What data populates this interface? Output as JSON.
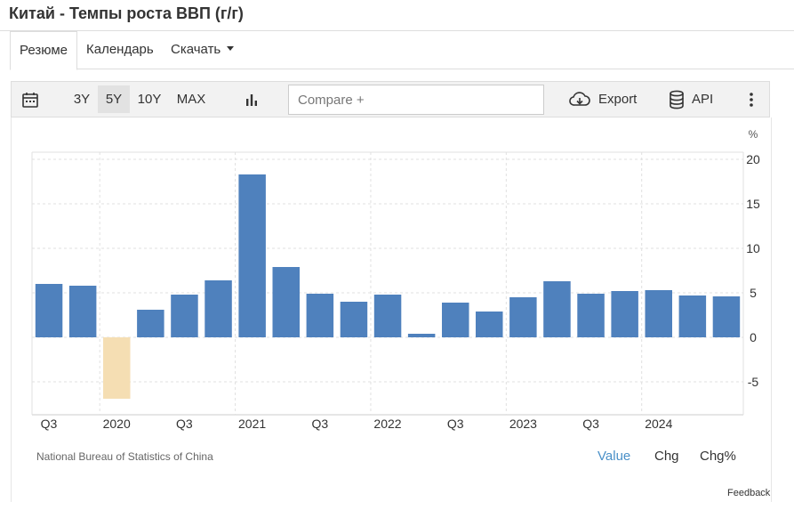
{
  "page": {
    "title": "Китай - Темпы роста ВВП (г/г)"
  },
  "tabs": [
    {
      "label": "Резюме",
      "active": true
    },
    {
      "label": "Календарь",
      "active": false
    },
    {
      "label": "Скачать",
      "active": false
    }
  ],
  "toolbar": {
    "ranges": [
      {
        "label": "3Y",
        "active": false
      },
      {
        "label": "5Y",
        "active": true
      },
      {
        "label": "10Y",
        "active": false
      },
      {
        "label": "MAX",
        "active": false
      }
    ],
    "compare_placeholder": "Compare +",
    "export_label": "Export",
    "api_label": "API"
  },
  "chart_data": {
    "type": "bar",
    "unit": "%",
    "categories": [
      "2019 Q3",
      "2019 Q4",
      "2020 Q1",
      "2020 Q2",
      "2020 Q3",
      "2020 Q4",
      "2021 Q1",
      "2021 Q2",
      "2021 Q3",
      "2021 Q4",
      "2022 Q1",
      "2022 Q2",
      "2022 Q3",
      "2022 Q4",
      "2023 Q1",
      "2023 Q2",
      "2023 Q3",
      "2023 Q4",
      "2024 Q1",
      "2024 Q2",
      "2024 Q3"
    ],
    "values": [
      6.0,
      5.8,
      -6.9,
      3.1,
      4.8,
      6.4,
      18.3,
      7.9,
      4.9,
      4.0,
      4.8,
      0.4,
      3.9,
      2.9,
      4.5,
      6.3,
      4.9,
      5.2,
      5.3,
      4.7,
      4.6
    ],
    "x_tick_labels": [
      "Q3",
      "2020",
      "Q3",
      "2021",
      "Q3",
      "2022",
      "Q3",
      "2023",
      "Q3",
      "2024"
    ],
    "y_ticks": [
      20,
      15,
      10,
      5,
      0,
      -5
    ],
    "ylim": [
      -8.7,
      20.8
    ],
    "colors": {
      "positive": "#4f81bd",
      "negative": "#f5deb3",
      "grid": "#e0e0e0"
    },
    "grid": true
  },
  "footer": {
    "source": "National Bureau of Statistics of China",
    "value_tabs": [
      {
        "label": "Value",
        "active": true
      },
      {
        "label": "Chg",
        "active": false
      },
      {
        "label": "Chg%",
        "active": false
      }
    ],
    "feedback": "Feedback"
  }
}
